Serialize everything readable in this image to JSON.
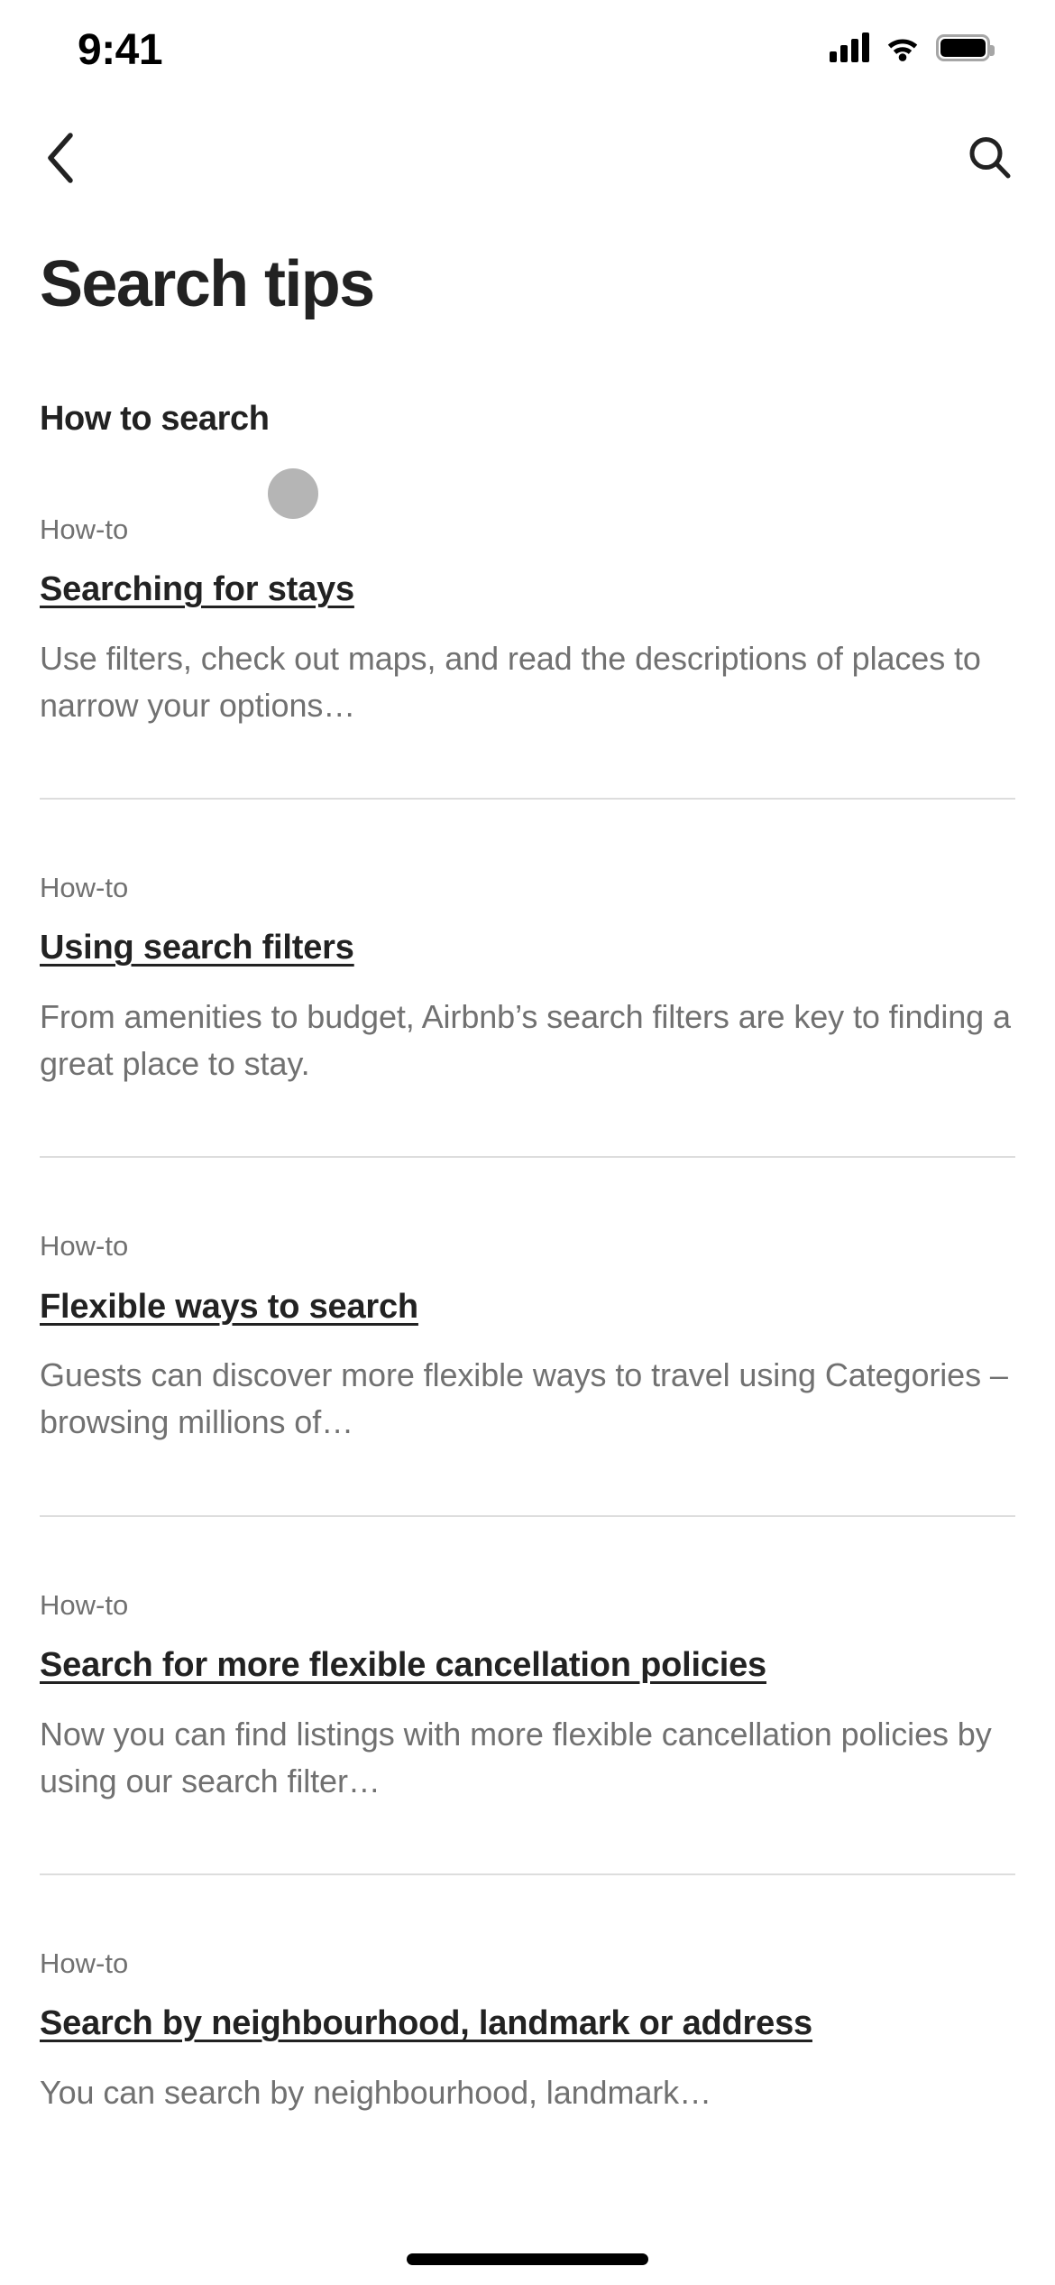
{
  "status_bar": {
    "time": "9:41",
    "icons": [
      "cellular-signal-icon",
      "wifi-icon",
      "battery-icon"
    ]
  },
  "nav_bar": {
    "back_icon": "chevron-left-icon",
    "search_icon": "search-icon"
  },
  "page": {
    "title": "Search tips"
  },
  "section": {
    "heading": "How to search"
  },
  "articles": [
    {
      "kicker": "How-to",
      "title": "Searching for stays",
      "description": "Use filters, check out maps, and read the descriptions of places to narrow your options…"
    },
    {
      "kicker": "How-to",
      "title": "Using search filters",
      "description": "From amenities to budget, Airbnb’s search filters are key to finding a great place to stay."
    },
    {
      "kicker": "How-to",
      "title": "Flexible ways to search",
      "description": "Guests can discover more flexible ways to travel using Categories – browsing millions of…"
    },
    {
      "kicker": "How-to",
      "title": "Search for more flexible cancellation policies",
      "description": "Now you can find listings with more flexible cancellation policies by using our search filter…"
    },
    {
      "kicker": "How-to",
      "title": "Search by neighbourhood, landmark or address",
      "description": "You can search by neighbourhood, landmark…"
    }
  ],
  "colors": {
    "text_primary": "#222222",
    "text_secondary": "#717171",
    "divider": "#dddddd",
    "background": "#ffffff",
    "tap_indicator": "#787878"
  }
}
